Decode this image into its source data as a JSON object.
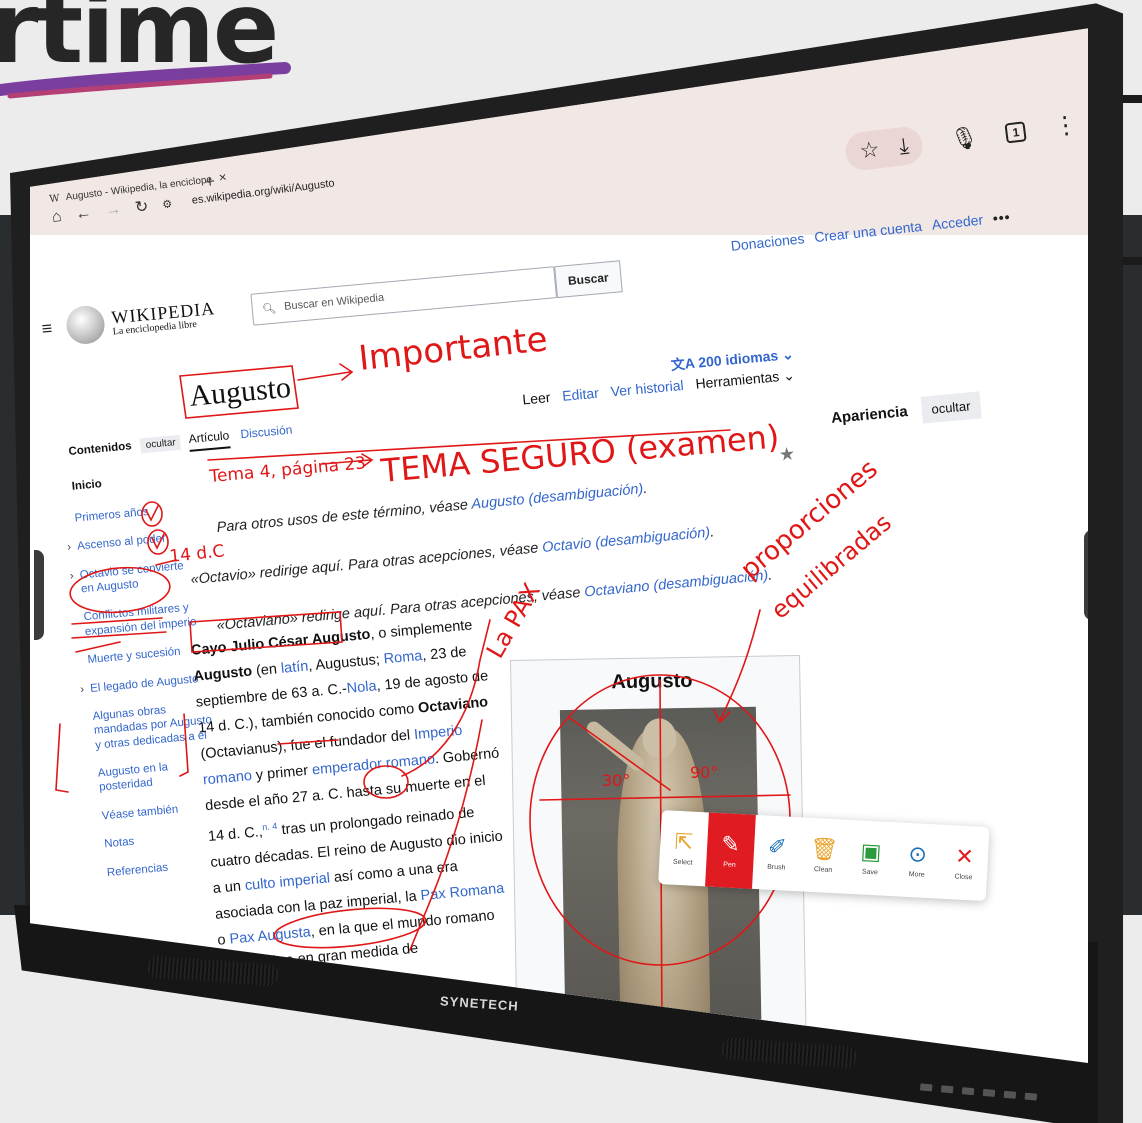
{
  "hero": {
    "headline": "rtime"
  },
  "browser": {
    "tab_title": "Augusto - Wikipedia, la enciclope",
    "tab_close": "✕",
    "new_tab": "+",
    "url": "es.wikipedia.org/wiki/Augusto",
    "tab_count": "1"
  },
  "wiki": {
    "logo_word": "WIKIPEDIA",
    "logo_tagline": "La enciclopedia libre",
    "search_placeholder": "Buscar en Wikipedia",
    "search_button": "Buscar",
    "top_links": [
      "Donaciones",
      "Crear una cuenta",
      "Acceder"
    ],
    "more": "•••",
    "title": "Augusto",
    "languages": "200 idiomas",
    "tabs": {
      "article": "Artículo",
      "discussion": "Discusión",
      "read": "Leer",
      "edit": "Editar",
      "history": "Ver historial",
      "tools": "Herramientas"
    },
    "toc": {
      "header": "Contenidos",
      "hide": "ocultar",
      "items": [
        "Inicio",
        "Primeros años",
        "Ascenso al poder",
        "Octavio se convierte en Augusto",
        "Conflictos militares y expansión del imperio",
        "Muerte y sucesión",
        "El legado de Augusto",
        "Algunas obras mandadas por Augusto y otras dedicadas a él",
        "Augusto en la posteridad",
        "Véase también",
        "Notas",
        "Referencias"
      ]
    },
    "hatnotes": [
      {
        "pre": "Para otros usos de este término, véase ",
        "link": "Augusto (desambiguación)",
        "post": "."
      },
      {
        "pre": "«Octavio» redirige aquí. Para otras acepciones, véase ",
        "link": "Octavio (desambiguación)",
        "post": "."
      },
      {
        "pre": "«Octaviano» redirige aquí. Para otras acepciones, véase ",
        "link": "Octaviano (desambiguación)",
        "post": "."
      }
    ],
    "body": {
      "s1": "Cayo Julio César Augusto",
      "s2": ", o simplemente ",
      "s3": "Augusto",
      "s4": " (en ",
      "s5": "latín",
      "s6": ", Augustus; ",
      "s7": "Roma",
      "s8": ", 23 de septiembre de 63 a. C.-",
      "s9": "Nola",
      "s10": ", 19 de agosto de 14 d. C.), también conocido como ",
      "s11": "Octaviano",
      "s12": " (Octavianus), fue el fundador del ",
      "s13": "Imperio romano",
      "s14": " y primer ",
      "s15": "emperador romano",
      "s16": ". Gobernó desde el año 27 a. C. hasta su muerte en el 14 d. C.,",
      "s17": "n. 4",
      "s18": " tras un prolongado reinado de cuatro décadas. El reino de Augusto dio inicio a un ",
      "s19": "culto imperial",
      "s20": " así como a una era asociada con la paz imperial, la ",
      "s21": "Pax Romana",
      "s22": " o ",
      "s23": "Pax Augusta",
      "s24": ", en la que el mundo romano estuvo libre en gran medida de"
    },
    "appearance": {
      "label": "Apariencia",
      "hide": "ocultar"
    },
    "infobox_title": "Augusto"
  },
  "annotations": {
    "importante": "Importante",
    "tema": "Tema 4, página 23",
    "seguro": "TEMA SEGURO (examen)",
    "date_14dc": "14 d.C",
    "proporciones": "proporciones",
    "equilibradas": "equilibradas",
    "pax": "La PAX",
    "angle1": "30°",
    "angle2": "90°"
  },
  "dock": {
    "tools": [
      {
        "label": "Select",
        "icon": "cursor-icon"
      },
      {
        "label": "Pen",
        "icon": "pen-icon"
      },
      {
        "label": "Brush",
        "icon": "brush-icon"
      },
      {
        "label": "Clean",
        "icon": "trash-icon"
      },
      {
        "label": "Save",
        "icon": "save-icon"
      },
      {
        "label": "More",
        "icon": "more-icon"
      },
      {
        "label": "Close",
        "icon": "close-icon"
      }
    ],
    "active": "Pen"
  },
  "device": {
    "brand": "SYNETECH"
  },
  "colors": {
    "ink": "#e01717",
    "link": "#3366cc",
    "pen_active": "#e11b22",
    "band": "#2a2d30"
  }
}
